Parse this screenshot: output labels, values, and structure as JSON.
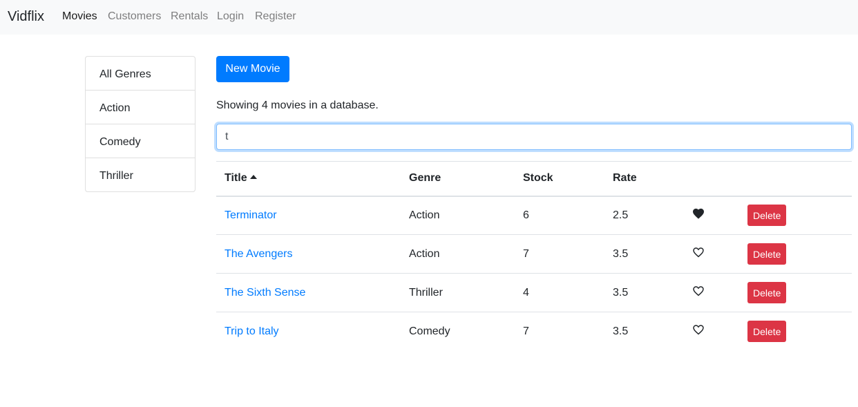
{
  "navbar": {
    "brand": "Vidflix",
    "links": [
      "Movies",
      "Customers",
      "Rentals",
      "Login",
      "Register"
    ],
    "active": "Movies"
  },
  "genres": [
    "All Genres",
    "Action",
    "Comedy",
    "Thriller"
  ],
  "actions": {
    "new_movie": "New Movie"
  },
  "summary": "Showing 4 movies in a database.",
  "search": {
    "value": "t",
    "placeholder": ""
  },
  "table": {
    "columns": [
      "Title",
      "Genre",
      "Stock",
      "Rate"
    ],
    "sort": {
      "column": "Title",
      "direction": "asc"
    },
    "rows": [
      {
        "title": "Terminator",
        "genre": "Action",
        "stock": "6",
        "rate": "2.5",
        "liked": true,
        "delete_label": "Delete"
      },
      {
        "title": "The Avengers",
        "genre": "Action",
        "stock": "7",
        "rate": "3.5",
        "liked": false,
        "delete_label": "Delete"
      },
      {
        "title": "The Sixth Sense",
        "genre": "Thriller",
        "stock": "4",
        "rate": "3.5",
        "liked": false,
        "delete_label": "Delete"
      },
      {
        "title": "Trip to Italy",
        "genre": "Comedy",
        "stock": "7",
        "rate": "3.5",
        "liked": false,
        "delete_label": "Delete"
      }
    ]
  },
  "colors": {
    "primary": "#007bff",
    "danger": "#dc3545",
    "navbar_bg": "#f8f9fa"
  },
  "icons": {
    "sort": "caret-up-icon",
    "liked": "heart-filled-icon",
    "unliked": "heart-outline-icon"
  }
}
